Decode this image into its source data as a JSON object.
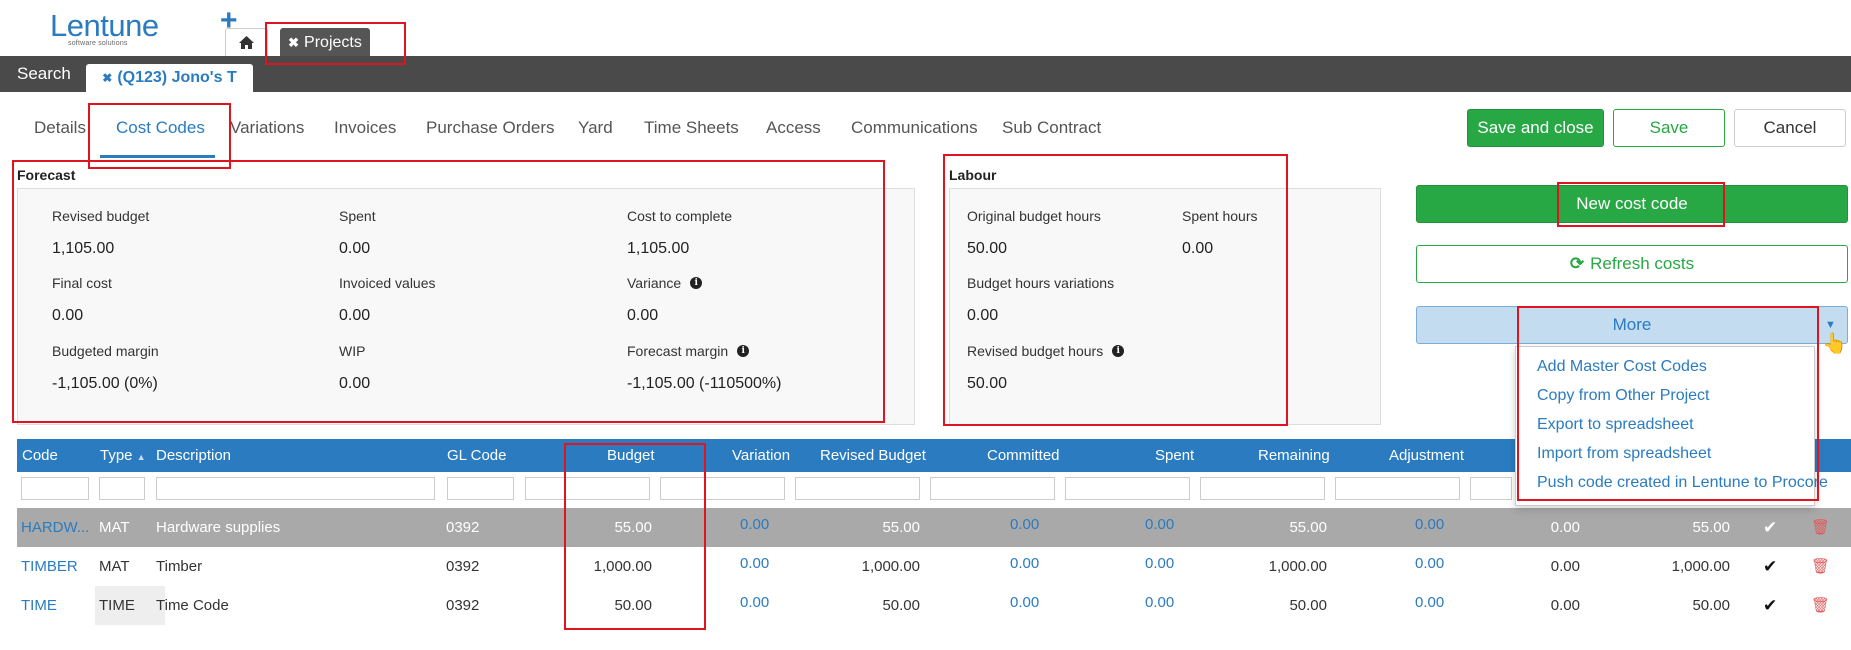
{
  "header": {
    "logo_name": "Lentune",
    "logo_tagline": "software solutions",
    "top_tabs": {
      "projects_label": "Projects"
    }
  },
  "subbar": {
    "search_label": "Search",
    "project_tab_label": "(Q123) Jono's T"
  },
  "nav": {
    "tabs": [
      "Details",
      "Cost Codes",
      "Variations",
      "Invoices",
      "Purchase Orders",
      "Yard",
      "Time Sheets",
      "Access",
      "Communications",
      "Sub Contract"
    ],
    "active": "Cost Codes"
  },
  "actions": {
    "save_close": "Save and close",
    "save": "Save",
    "cancel": "Cancel",
    "new_cost_code": "New cost code",
    "refresh_costs": "Refresh costs",
    "more": "More"
  },
  "more_menu": {
    "items": [
      "Add Master Cost Codes",
      "Copy from Other Project",
      "Export to spreadsheet",
      "Import from spreadsheet",
      "Push code created in Lentune to Procore"
    ]
  },
  "forecast": {
    "title": "Forecast",
    "revised_budget": {
      "label": "Revised budget",
      "value": "1,105.00"
    },
    "spent": {
      "label": "Spent",
      "value": "0.00"
    },
    "cost_to_complete": {
      "label": "Cost to complete",
      "value": "1,105.00"
    },
    "final_cost": {
      "label": "Final cost",
      "value": "0.00"
    },
    "invoiced_values": {
      "label": "Invoiced values",
      "value": "0.00"
    },
    "variance": {
      "label": "Variance",
      "value": "0.00"
    },
    "budgeted_margin": {
      "label": "Budgeted margin",
      "value": "-1,105.00 (0%)"
    },
    "wip": {
      "label": "WIP",
      "value": "0.00"
    },
    "forecast_margin": {
      "label": "Forecast margin",
      "value": "-1,105.00 (-110500%)"
    }
  },
  "labour": {
    "title": "Labour",
    "original_budget_hours": {
      "label": "Original budget hours",
      "value": "50.00"
    },
    "spent_hours": {
      "label": "Spent hours",
      "value": "0.00"
    },
    "budget_hours_variations": {
      "label": "Budget hours variations",
      "value": "0.00"
    },
    "revised_budget_hours": {
      "label": "Revised budget hours",
      "value": "50.00"
    }
  },
  "table": {
    "columns": [
      "Code",
      "Type",
      "Description",
      "GL Code",
      "Budget",
      "Variation",
      "Revised Budget",
      "Committed",
      "Spent",
      "Remaining",
      "Adjustment"
    ],
    "rows": [
      {
        "code": "HARDW...",
        "type": "MAT",
        "description": "Hardware supplies",
        "gl_code": "0392",
        "budget": "55.00",
        "variation": "0.00",
        "revised_budget": "55.00",
        "committed": "0.00",
        "spent": "0.00",
        "remaining": "55.00",
        "adjustment": "0.00",
        "col12": "0.00",
        "col13": "55.00"
      },
      {
        "code": "TIMBER",
        "type": "MAT",
        "description": "Timber",
        "gl_code": "0392",
        "budget": "1,000.00",
        "variation": "0.00",
        "revised_budget": "1,000.00",
        "committed": "0.00",
        "spent": "0.00",
        "remaining": "1,000.00",
        "adjustment": "0.00",
        "col12": "0.00",
        "col13": "1,000.00"
      },
      {
        "code": "TIME",
        "type": "TIME",
        "description": "Time Code",
        "gl_code": "0392",
        "budget": "50.00",
        "variation": "0.00",
        "revised_budget": "50.00",
        "committed": "0.00",
        "spent": "0.00",
        "remaining": "50.00",
        "adjustment": "0.00",
        "col12": "0.00",
        "col13": "50.00"
      }
    ]
  },
  "colors": {
    "brand_blue": "#2a7bc0",
    "success_green": "#28a745",
    "annotation_red": "#e0141e",
    "delete_red": "#e05a5a"
  }
}
